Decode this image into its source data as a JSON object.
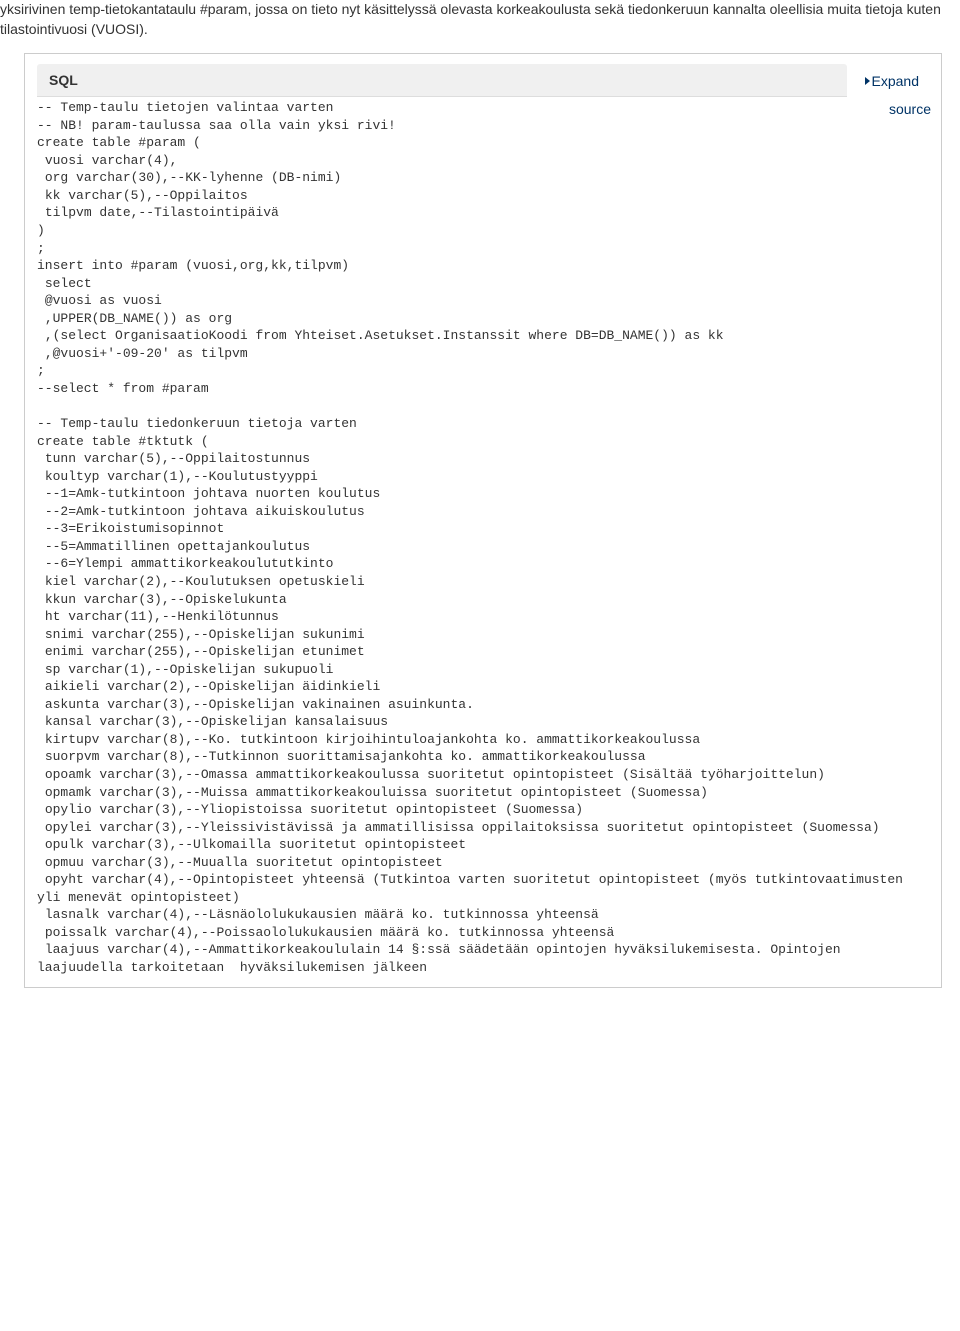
{
  "intro": "yksirivinen temp-tietokantataulu #param, jossa on tieto nyt käsittelyssä olevasta korkeakoulusta sekä tiedonkeruun kannalta oleellisia muita tietoja kuten tilastointivuosi (VUOSI).",
  "code_header": "SQL",
  "expand_label": "Expand",
  "source_label": "source",
  "sql": "-- Temp-taulu tietojen valintaa varten\n-- NB! param-taulussa saa olla vain yksi rivi!\ncreate table #param (\n vuosi varchar(4),\n org varchar(30),--KK-lyhenne (DB-nimi)\n kk varchar(5),--Oppilaitos\n tilpvm date,--Tilastointipäivä\n)\n;\ninsert into #param (vuosi,org,kk,tilpvm)\n select\n @vuosi as vuosi\n ,UPPER(DB_NAME()) as org\n ,(select OrganisaatioKoodi from Yhteiset.Asetukset.Instanssit where DB=DB_NAME()) as kk\n ,@vuosi+'-09-20' as tilpvm\n;\n--select * from #param\n\n-- Temp-taulu tiedonkeruun tietoja varten\ncreate table #tktutk (\n tunn varchar(5),--Oppilaitostunnus\n koultyp varchar(1),--Koulutustyyppi\n --1=Amk-tutkintoon johtava nuorten koulutus\n --2=Amk-tutkintoon johtava aikuiskoulutus\n --3=Erikoistumisopinnot\n --5=Ammatillinen opettajankoulutus\n --6=Ylempi ammattikorkeakoulututkinto\n kiel varchar(2),--Koulutuksen opetuskieli\n kkun varchar(3),--Opiskelukunta\n ht varchar(11),--Henkilötunnus\n snimi varchar(255),--Opiskelijan sukunimi\n enimi varchar(255),--Opiskelijan etunimet\n sp varchar(1),--Opiskelijan sukupuoli\n aikieli varchar(2),--Opiskelijan äidinkieli\n askunta varchar(3),--Opiskelijan vakinainen asuinkunta.\n kansal varchar(3),--Opiskelijan kansalaisuus\n kirtupv varchar(8),--Ko. tutkintoon kirjoihintuloajankohta ko. ammattikorkeakoulussa\n suorpvm varchar(8),--Tutkinnon suorittamisajankohta ko. ammattikorkeakoulussa\n opoamk varchar(3),--Omassa ammattikorkeakoulussa suoritetut opintopisteet (Sisältää työharjoittelun)\n opmamk varchar(3),--Muissa ammattikorkeakouluissa suoritetut opintopisteet (Suomessa)\n opylio varchar(3),--Yliopistoissa suoritetut opintopisteet (Suomessa)\n opylei varchar(3),--Yleissivistävissä ja ammatillisissa oppilaitoksissa suoritetut opintopisteet (Suomessa)\n opulk varchar(3),--Ulkomailla suoritetut opintopisteet\n opmuu varchar(3),--Muualla suoritetut opintopisteet\n opyht varchar(4),--Opintopisteet yhteensä (Tutkintoa varten suoritetut opintopisteet (myös tutkintovaatimusten yli menevät opintopisteet)\n lasnalk varchar(4),--Läsnäololukukausien määrä ko. tutkinnossa yhteensä\n poissalk varchar(4),--Poissaololukukausien määrä ko. tutkinnossa yhteensä\n laajuus varchar(4),--Ammattikorkeakoululain 14 §:ssä säädetään opintojen hyväksilukemisesta. Opintojen laajuudella tarkoitetaan  hyväksilukemisen jälkeen"
}
